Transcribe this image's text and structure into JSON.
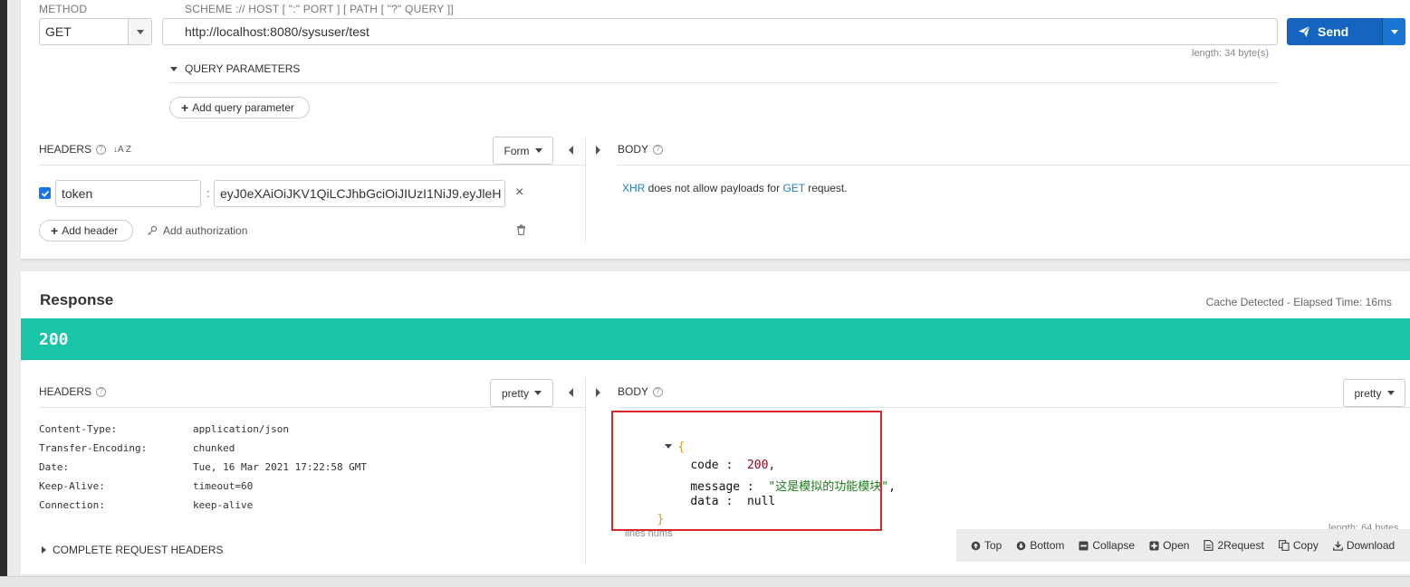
{
  "request": {
    "method_label": "METHOD",
    "method_value": "GET",
    "url_hint": "SCHEME :// HOST [ \":\" PORT ] [ PATH [ \"?\" QUERY ]]",
    "url_value": "http://localhost:8080/sysuser/test",
    "length_text": "length: 34 byte(s)",
    "send_label": "Send",
    "query_params_label": "QUERY PARAMETERS",
    "add_query_param_label": "Add query parameter",
    "headers_label": "HEADERS",
    "sort_icon_text": "↓A Z",
    "form_label": "Form",
    "header_row": {
      "checked": true,
      "name": "token",
      "separator": ":",
      "value": "eyJ0eXAiOiJKV1QiLCJhbGciOiJIUzI1NiJ9.eyJleH"
    },
    "add_header_label": "Add header",
    "add_authorization_label": "Add authorization",
    "body_label": "BODY",
    "body_note": {
      "xhr": "XHR",
      "middle": " does not allow payloads for ",
      "get": "GET",
      "end": " request."
    }
  },
  "response": {
    "title": "Response",
    "timing": "Cache Detected - Elapsed Time: 16ms",
    "status_code": "200",
    "headers_label": "HEADERS",
    "headers_mode": "pretty",
    "headers": [
      {
        "key": "Content-Type:",
        "value": "application/json"
      },
      {
        "key": "Transfer-Encoding:",
        "value": "chunked"
      },
      {
        "key": "Date:",
        "value": "Tue, 16 Mar 2021 17:22:58 GMT"
      },
      {
        "key": "Keep-Alive:",
        "value": "timeout=60"
      },
      {
        "key": "Connection:",
        "value": "keep-alive"
      }
    ],
    "complete_request_headers_label": "COMPLETE REQUEST HEADERS",
    "body_label": "BODY",
    "body_mode": "pretty",
    "json": {
      "open": "{",
      "close": "}",
      "code_key": "code",
      "code_value": "200",
      "message_key": "message",
      "message_value": "\"这是模拟的功能模块\"",
      "data_key": "data",
      "data_value": "null"
    },
    "lines_nums_label": "lines nums",
    "length_text": "length: 64 bytes",
    "toolbar": {
      "top": "Top",
      "bottom": "Bottom",
      "collapse": "Collapse",
      "open": "Open",
      "to_request": "2Request",
      "copy": "Copy",
      "download": "Download"
    }
  },
  "colors": {
    "status_bar": "#1ac4a6",
    "send_button": "#1565c0",
    "highlight_box": "#d9262c"
  }
}
